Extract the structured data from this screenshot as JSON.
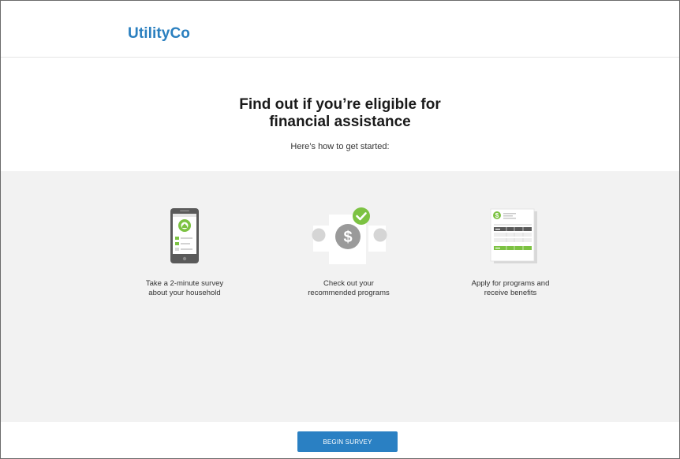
{
  "header": {
    "logo_text": "UtilityCo"
  },
  "intro": {
    "title_line1": "Find out if you’re eligible for",
    "title_line2": "financial assistance",
    "subtitle": "Here’s how to get started:"
  },
  "steps": [
    {
      "icon": "phone-survey-icon",
      "label_line1": "Take a 2-minute survey",
      "label_line2": "about your household"
    },
    {
      "icon": "dollar-check-icon",
      "label_line1": "Check out your",
      "label_line2": "recommended programs"
    },
    {
      "icon": "application-form-icon",
      "label_line1": "Apply for programs and",
      "label_line2": "receive benefits"
    }
  ],
  "footer": {
    "begin_label": "BEGIN SURVEY"
  },
  "colors": {
    "brand": "#2a7fbf",
    "button": "#2a80c3",
    "accent_green": "#7cc242",
    "band_bg": "#f2f2f2"
  }
}
